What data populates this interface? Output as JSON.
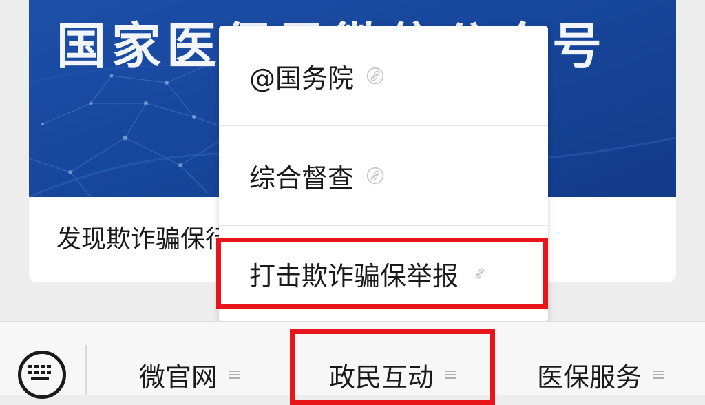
{
  "article": {
    "banner_title": "国家医保局微信公众号",
    "title": "发现欺诈骗保行为怎么举报？"
  },
  "popup_menu": {
    "items": [
      {
        "label": "@国务院",
        "icon": "link-icon"
      },
      {
        "label": "综合督查",
        "icon": "link-icon"
      },
      {
        "label": "打击欺诈骗保举报",
        "icon": "link-icon",
        "highlighted": true
      }
    ]
  },
  "tabbar": {
    "keyboard_icon": "keyboard-icon",
    "tabs": [
      {
        "label": "微官网",
        "icon": "menu-lines-icon"
      },
      {
        "label": "政民互动",
        "icon": "menu-lines-icon",
        "highlighted": true
      },
      {
        "label": "医保服务",
        "icon": "menu-lines-icon"
      }
    ]
  },
  "colors": {
    "banner_blue": "#17479c",
    "highlight_red": "#e8161b",
    "background": "#ededed"
  }
}
